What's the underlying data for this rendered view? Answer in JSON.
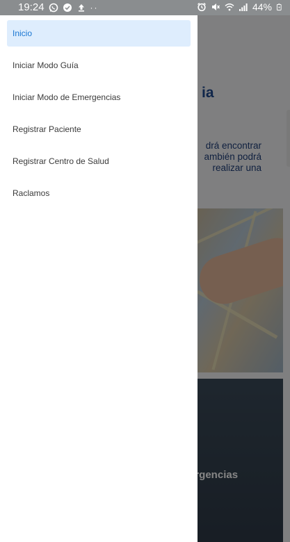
{
  "status_bar": {
    "time": "19:24",
    "left_icons": [
      "whatsapp-icon",
      "check-circle-icon",
      "upload-icon"
    ],
    "more_dots": "··",
    "right_icons": [
      "alarm-icon",
      "mute-icon",
      "wifi-icon",
      "signal-icon"
    ],
    "battery_percent": "44%",
    "battery_icon": "battery-charging-icon"
  },
  "drawer": {
    "items": [
      {
        "label": "Inicio",
        "active": true
      },
      {
        "label": "Iniciar Modo Guía",
        "active": false
      },
      {
        "label": "Iniciar Modo de Emergencias",
        "active": false
      },
      {
        "label": "Registrar Paciente",
        "active": false
      },
      {
        "label": "Registrar Centro de Salud",
        "active": false
      },
      {
        "label": "Raclamos",
        "active": false
      }
    ],
    "active_color": "#1976d2",
    "active_bg": "#deedfd"
  },
  "background": {
    "title_fragment": "ia",
    "paragraph_lines": [
      "drá encontrar",
      "ambién podrá",
      "realizar una"
    ],
    "dark_card_label": "ergencias"
  }
}
